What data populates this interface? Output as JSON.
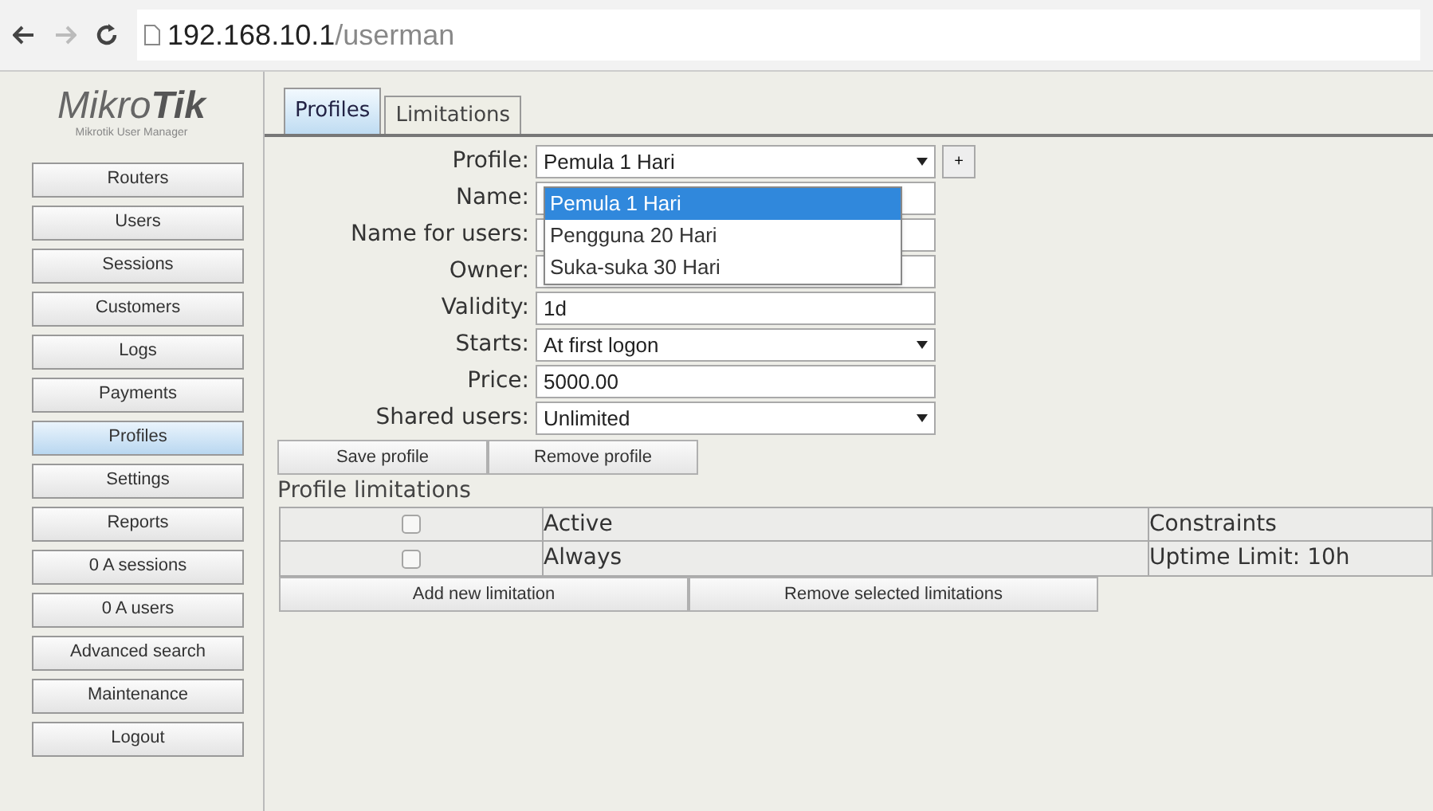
{
  "browser": {
    "url_host": "192.168.10.1",
    "url_path": "/userman"
  },
  "logo": {
    "light": "Mikro",
    "bold": "Tik",
    "subtitle": "Mikrotik User Manager"
  },
  "sidebar": {
    "items": [
      {
        "label": "Routers",
        "selected": false
      },
      {
        "label": "Users",
        "selected": false
      },
      {
        "label": "Sessions",
        "selected": false
      },
      {
        "label": "Customers",
        "selected": false
      },
      {
        "label": "Logs",
        "selected": false
      },
      {
        "label": "Payments",
        "selected": false
      },
      {
        "label": "Profiles",
        "selected": true
      },
      {
        "label": "Settings",
        "selected": false
      },
      {
        "label": "Reports",
        "selected": false
      },
      {
        "label": "0 A sessions",
        "selected": false
      },
      {
        "label": "0 A users",
        "selected": false
      },
      {
        "label": "Advanced search",
        "selected": false
      },
      {
        "label": "Maintenance",
        "selected": false
      },
      {
        "label": "Logout",
        "selected": false
      }
    ]
  },
  "tabs": [
    {
      "label": "Profiles",
      "selected": true
    },
    {
      "label": "Limitations",
      "selected": false
    }
  ],
  "form": {
    "fields": [
      {
        "kind": "select",
        "label": "Profile:",
        "value": "Pemula 1 Hari",
        "add_button": "+"
      },
      {
        "kind": "text",
        "label": "Name:"
      },
      {
        "kind": "text",
        "label": "Name for users:"
      },
      {
        "kind": "text",
        "label": "Owner:"
      },
      {
        "kind": "text",
        "label": "Validity:",
        "value": "1d"
      },
      {
        "kind": "select",
        "label": "Starts:",
        "value": "At first logon"
      },
      {
        "kind": "text",
        "label": "Price:",
        "value": "5000.00"
      },
      {
        "kind": "select",
        "label": "Shared users:",
        "value": "Unlimited"
      }
    ],
    "buttons": [
      "Save profile",
      "Remove profile"
    ]
  },
  "profile_dropdown": {
    "options": [
      {
        "label": "Pemula 1 Hari",
        "selected": true
      },
      {
        "label": "Pengguna 20 Hari",
        "selected": false
      },
      {
        "label": "Suka-suka 30 Hari",
        "selected": false
      }
    ]
  },
  "limitations": {
    "title": "Profile limitations",
    "columns": [
      "Active",
      "Constraints"
    ],
    "header_checked": false,
    "rows": [
      {
        "checked": false,
        "active": "Always",
        "constraints": "Uptime Limit: 10h"
      }
    ],
    "buttons": [
      "Add new limitation",
      "Remove selected limitations"
    ]
  }
}
